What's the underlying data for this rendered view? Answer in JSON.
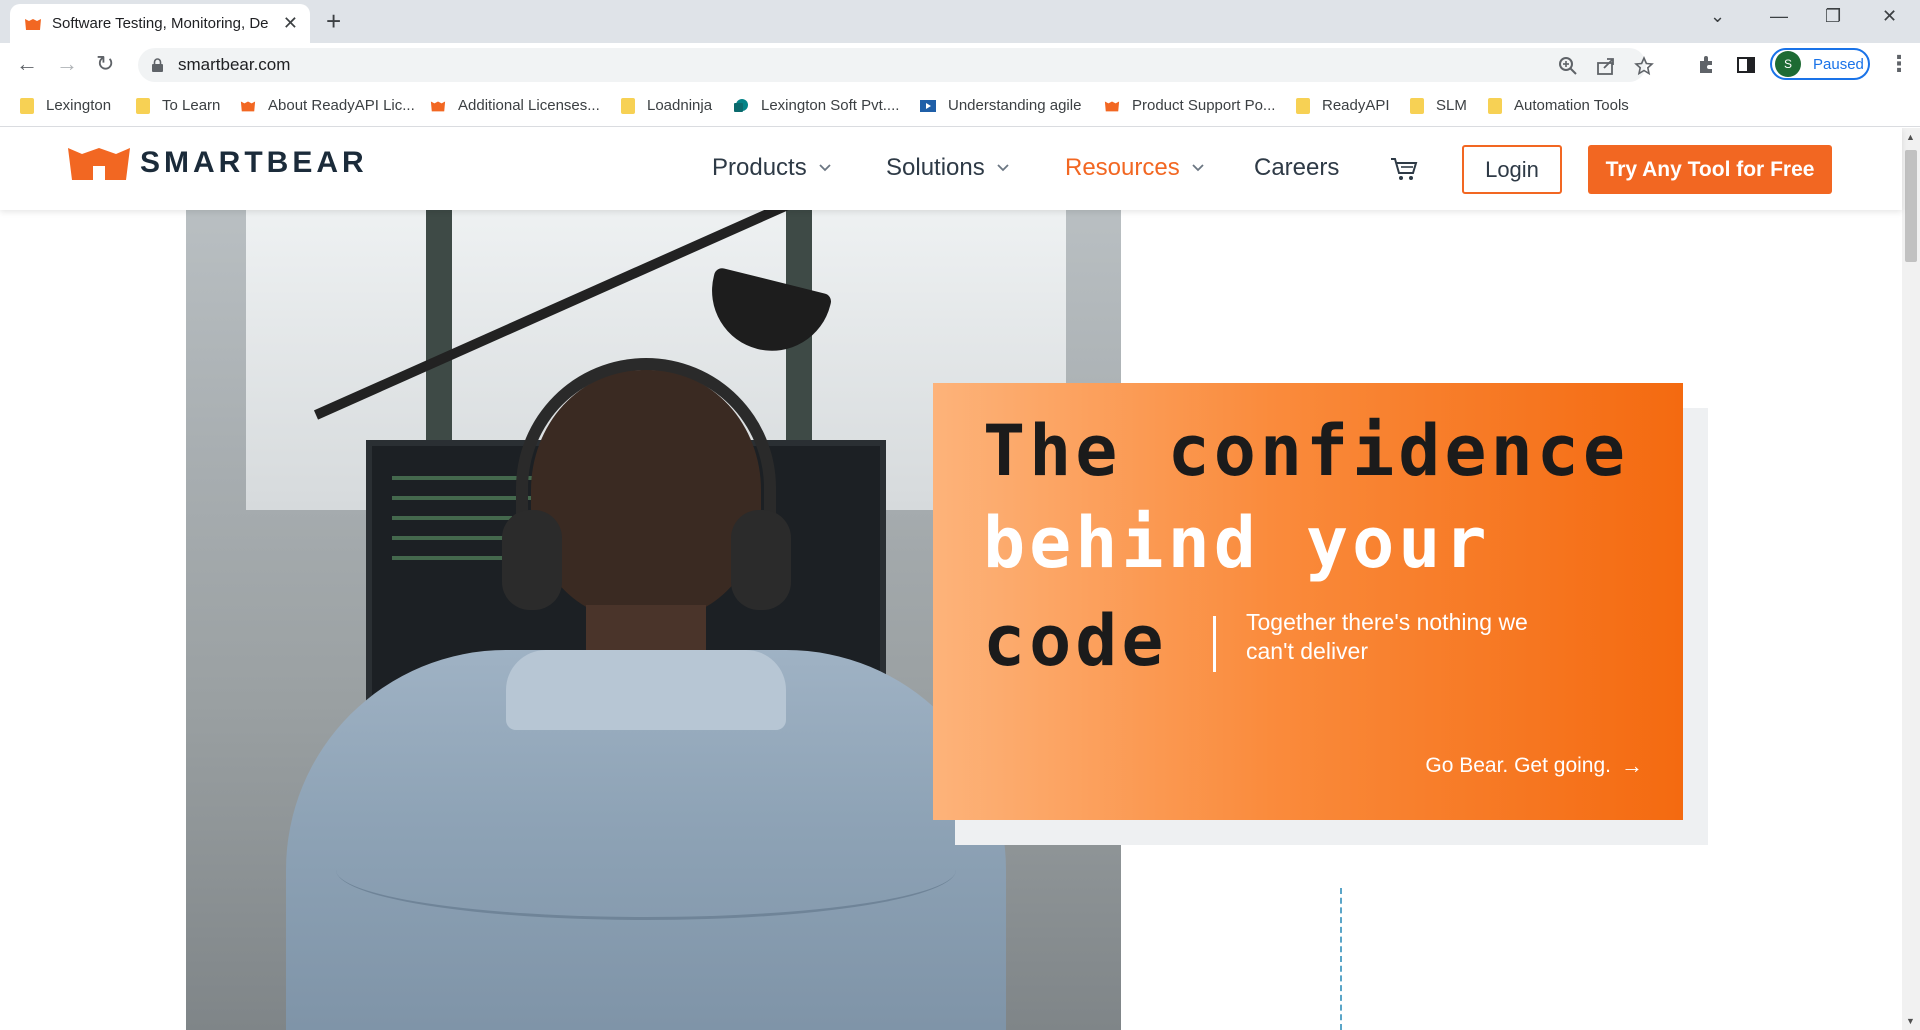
{
  "browser": {
    "tab": {
      "title": "Software Testing, Monitoring, De"
    },
    "address": {
      "url": "smartbear.com"
    },
    "profile": {
      "initial": "S",
      "status": "Paused"
    },
    "bookmarks": [
      {
        "label": "Lexington",
        "icon": "folder-icon"
      },
      {
        "label": "To Learn",
        "icon": "folder-icon"
      },
      {
        "label": "About ReadyAPI Lic...",
        "icon": "smartbear-icon"
      },
      {
        "label": "Additional Licenses...",
        "icon": "smartbear-icon"
      },
      {
        "label": "Loadninja",
        "icon": "folder-icon"
      },
      {
        "label": "Lexington Soft Pvt....",
        "icon": "sharepoint-icon"
      },
      {
        "label": "Understanding agile",
        "icon": "video-icon"
      },
      {
        "label": "Product Support Po...",
        "icon": "smartbear-icon"
      },
      {
        "label": "ReadyAPI",
        "icon": "folder-icon"
      },
      {
        "label": "SLM",
        "icon": "folder-icon"
      },
      {
        "label": "Automation Tools",
        "icon": "folder-icon"
      }
    ]
  },
  "site": {
    "logo_text": "SMARTBEAR",
    "nav": [
      {
        "label": "Products",
        "active": false
      },
      {
        "label": "Solutions",
        "active": false
      },
      {
        "label": "Resources",
        "active": true
      },
      {
        "label": "Careers",
        "active": false
      }
    ],
    "login_label": "Login",
    "try_label": "Try Any Tool for Free"
  },
  "hero": {
    "line1": "The confidence",
    "line2": "behind your",
    "line3": "code",
    "tagline": "Together there's nothing we can't deliver",
    "cta": "Go Bear. Get going."
  },
  "colors": {
    "brand_orange": "#f26722",
    "text_dark": "#2e3a46",
    "card_gradient_start": "#fdb37a",
    "card_gradient_end": "#f46a10"
  }
}
